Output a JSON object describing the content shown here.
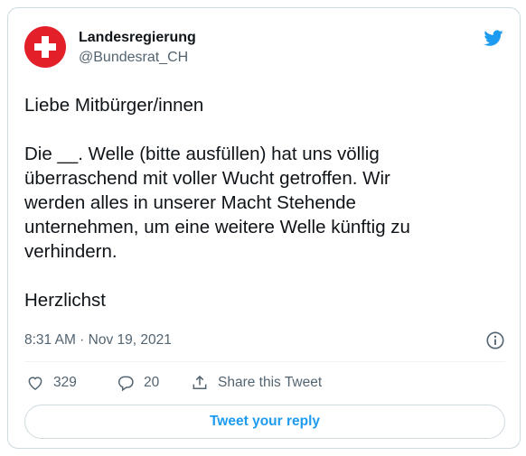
{
  "account": {
    "display_name": "Landesregierung",
    "handle": "@Bundesrat_CH"
  },
  "tweet": {
    "lines": [
      "Liebe Mitbürger/innen",
      "Die __. Welle (bitte ausfüllen) hat uns völlig",
      "überraschend mit voller Wucht getroffen. Wir",
      "werden alles in unserer Macht Stehende",
      "unternehmen, um eine weitere Welle künftig zu",
      "verhindern.",
      "Herzlichst"
    ],
    "timestamp": "8:31 AM · Nov 19, 2021"
  },
  "actions": {
    "likes": "329",
    "replies": "20",
    "share_label": "Share this Tweet"
  },
  "reply_button": {
    "label": "Tweet your reply"
  },
  "icons": {
    "avatar": "swiss-cross-icon",
    "brand": "twitter-bird-icon",
    "info": "info-icon",
    "like": "heart-icon",
    "reply": "reply-bubble-icon",
    "share": "share-icon"
  },
  "colors": {
    "accent": "#1d9bf0",
    "avatar_red": "#e3202a",
    "muted_text": "#536471",
    "border": "#cfd9de"
  }
}
